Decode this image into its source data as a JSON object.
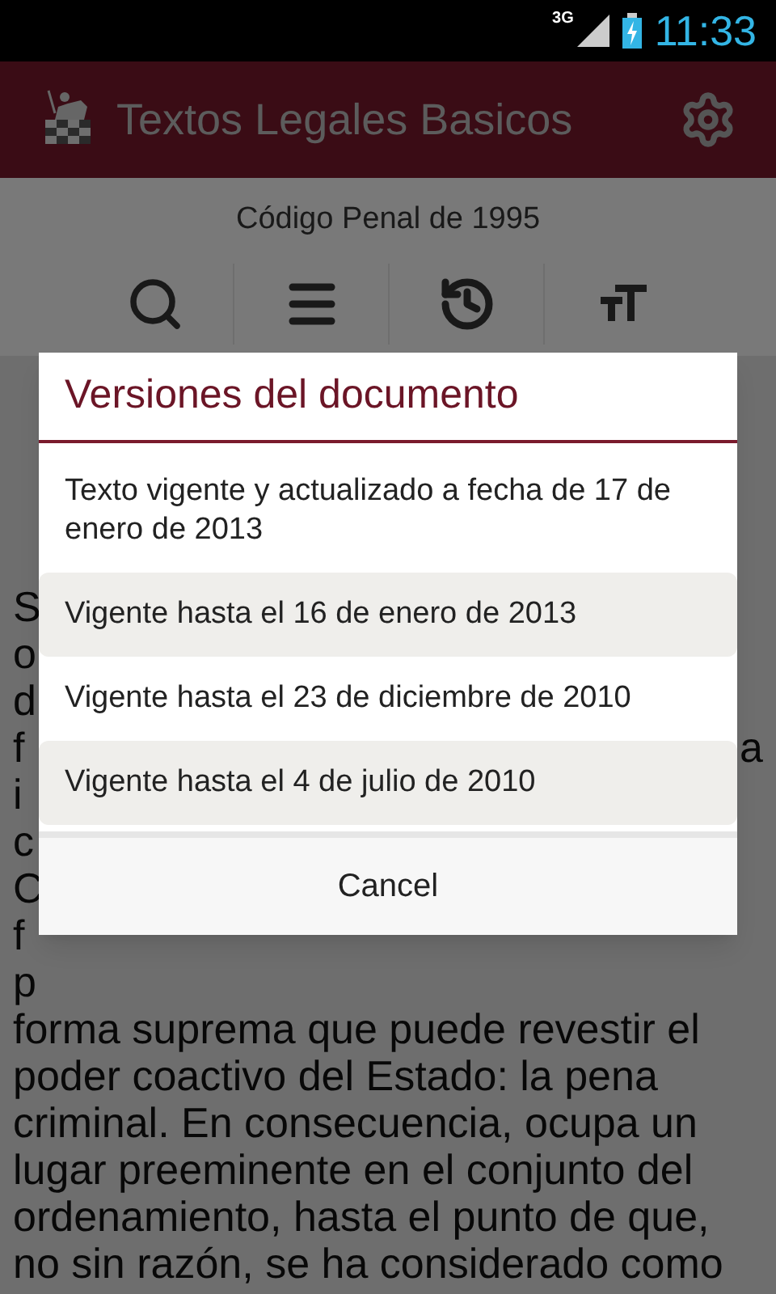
{
  "status_bar": {
    "network": "3G",
    "time": "11:33"
  },
  "app_bar": {
    "title": "Textos Legales Basicos"
  },
  "document": {
    "title": "Código Penal de 1995"
  },
  "toolbar": [
    {
      "kind": "search"
    },
    {
      "kind": "menu"
    },
    {
      "kind": "history"
    },
    {
      "kind": "font-size"
    }
  ],
  "body_lines": [
    {
      "left": "S"
    },
    {
      "left": "o"
    },
    {
      "left": "d"
    },
    {
      "left": "f",
      "right": "a"
    },
    {
      "left": "i"
    },
    {
      "left": "c"
    },
    {
      "left": "C"
    },
    {
      "left": "f"
    },
    {
      "left": "p"
    },
    {
      "left": "forma suprema que puede revestir el"
    },
    {
      "left": "poder coactivo del Estado: la pena"
    },
    {
      "left": "criminal. En consecuencia, ocupa un"
    },
    {
      "left": "lugar preeminente en el conjunto del"
    },
    {
      "left": "ordenamiento, hasta el punto de que,"
    },
    {
      "left": "no sin razón, se ha considerado como"
    }
  ],
  "dialog": {
    "title": "Versiones del documento",
    "options": [
      {
        "label": "Texto vigente y actualizado a fecha de 17 de enero de 2013",
        "shaded": false
      },
      {
        "label": "Vigente hasta el 16 de enero de 2013",
        "shaded": true
      },
      {
        "label": "Vigente hasta el 23 de diciembre de 2010",
        "shaded": false
      },
      {
        "label": "Vigente hasta el 4 de julio de 2010",
        "shaded": true
      }
    ],
    "cancel": "Cancel"
  }
}
